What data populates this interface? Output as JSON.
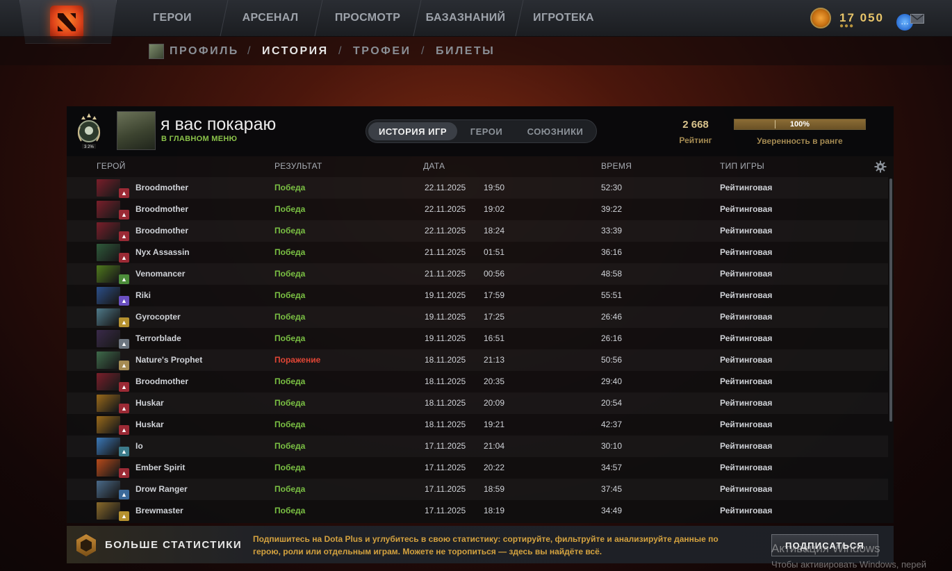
{
  "topnav": {
    "tabs": [
      "ГЕРОИ",
      "АРСЕНАЛ",
      "ПРОСМОТР",
      "БАЗАЗНАНИЙ",
      "ИГРОТЕКА"
    ],
    "currency": "17 050"
  },
  "subnav": {
    "items": [
      "ПРОФИЛЬ",
      "ИСТОРИЯ",
      "ТРОФЕИ",
      "БИЛЕТЫ"
    ],
    "active": "ИСТОРИЯ"
  },
  "player": {
    "name": "я вас покараю",
    "status": "В ГЛАВНОМ МЕНЮ",
    "rank_badge_text": "3 2%"
  },
  "segment_tabs": [
    "ИСТОРИЯ ИГР",
    "ГЕРОИ",
    "СОЮЗНИКИ"
  ],
  "rating": {
    "value": "2 668",
    "label": "Рейтинг",
    "confidence_text": "100%",
    "confidence_fraction": 1.0,
    "confidence_label": "Уверенность в ранге"
  },
  "columns": {
    "hero": "ГЕРОЙ",
    "result": "РЕЗУЛЬТАТ",
    "date": "ДАТА",
    "duration": "ВРЕМЯ",
    "mode": "ТИП ИГРЫ"
  },
  "matches": [
    {
      "hero": "Broodmother",
      "result": "Победа",
      "win": true,
      "date": "22.11.2025",
      "time": "19:50",
      "duration": "52:30",
      "mode": "Рейтинговая",
      "hero_color": "#7a1e2a",
      "role_color": "#9b2a35"
    },
    {
      "hero": "Broodmother",
      "result": "Победа",
      "win": true,
      "date": "22.11.2025",
      "time": "19:02",
      "duration": "39:22",
      "mode": "Рейтинговая",
      "hero_color": "#7a1e2a",
      "role_color": "#9b2a35"
    },
    {
      "hero": "Broodmother",
      "result": "Победа",
      "win": true,
      "date": "22.11.2025",
      "time": "18:24",
      "duration": "33:39",
      "mode": "Рейтинговая",
      "hero_color": "#7a1e2a",
      "role_color": "#9b2a35"
    },
    {
      "hero": "Nyx Assassin",
      "result": "Победа",
      "win": true,
      "date": "21.11.2025",
      "time": "01:51",
      "duration": "36:16",
      "mode": "Рейтинговая",
      "hero_color": "#2e5a3a",
      "role_color": "#9b2a35"
    },
    {
      "hero": "Venomancer",
      "result": "Победа",
      "win": true,
      "date": "21.11.2025",
      "time": "00:56",
      "duration": "48:58",
      "mode": "Рейтинговая",
      "hero_color": "#4f7a1c",
      "role_color": "#4c8c3a"
    },
    {
      "hero": "Riki",
      "result": "Победа",
      "win": true,
      "date": "19.11.2025",
      "time": "17:59",
      "duration": "55:51",
      "mode": "Рейтинговая",
      "hero_color": "#2b4f8a",
      "role_color": "#6a4fc0"
    },
    {
      "hero": "Gyrocopter",
      "result": "Победа",
      "win": true,
      "date": "19.11.2025",
      "time": "17:25",
      "duration": "26:46",
      "mode": "Рейтинговая",
      "hero_color": "#4f7a8a",
      "role_color": "#b5912f"
    },
    {
      "hero": "Terrorblade",
      "result": "Победа",
      "win": true,
      "date": "19.11.2025",
      "time": "16:51",
      "duration": "26:16",
      "mode": "Рейтинговая",
      "hero_color": "#3a2a4a",
      "role_color": "#6d7680"
    },
    {
      "hero": "Nature's Prophet",
      "result": "Поражение",
      "win": false,
      "date": "18.11.2025",
      "time": "21:13",
      "duration": "50:56",
      "mode": "Рейтинговая",
      "hero_color": "#3e6a4a",
      "role_color": "#a58b53"
    },
    {
      "hero": "Broodmother",
      "result": "Победа",
      "win": true,
      "date": "18.11.2025",
      "time": "20:35",
      "duration": "29:40",
      "mode": "Рейтинговая",
      "hero_color": "#7a1e2a",
      "role_color": "#9b2a35"
    },
    {
      "hero": "Huskar",
      "result": "Победа",
      "win": true,
      "date": "18.11.2025",
      "time": "20:09",
      "duration": "20:54",
      "mode": "Рейтинговая",
      "hero_color": "#9a6a1a",
      "role_color": "#9b2a35"
    },
    {
      "hero": "Huskar",
      "result": "Победа",
      "win": true,
      "date": "18.11.2025",
      "time": "19:21",
      "duration": "42:37",
      "mode": "Рейтинговая",
      "hero_color": "#9a6a1a",
      "role_color": "#9b2a35"
    },
    {
      "hero": "Io",
      "result": "Победа",
      "win": true,
      "date": "17.11.2025",
      "time": "21:04",
      "duration": "30:10",
      "mode": "Рейтинговая",
      "hero_color": "#3a78b8",
      "role_color": "#3c7b8a"
    },
    {
      "hero": "Ember Spirit",
      "result": "Победа",
      "win": true,
      "date": "17.11.2025",
      "time": "20:22",
      "duration": "34:57",
      "mode": "Рейтинговая",
      "hero_color": "#b84a1a",
      "role_color": "#9b2a35"
    },
    {
      "hero": "Drow Ranger",
      "result": "Победа",
      "win": true,
      "date": "17.11.2025",
      "time": "18:59",
      "duration": "37:45",
      "mode": "Рейтинговая",
      "hero_color": "#4a6a8a",
      "role_color": "#3c6a9a"
    },
    {
      "hero": "Brewmaster",
      "result": "Победа",
      "win": true,
      "date": "17.11.2025",
      "time": "18:19",
      "duration": "34:49",
      "mode": "Рейтинговая",
      "hero_color": "#8a6a2a",
      "role_color": "#b5912f"
    }
  ],
  "banner": {
    "title": "БОЛЬШЕ СТАТИСТИКИ",
    "text": "Подпишитесь на Dota Plus и углубитесь в свою статистику: сортируйте, фильтруйте и анализируйте данные по герою, роли или отдельным играм. Можете не торопиться — здесь вы найдёте всё.",
    "button": "ПОДПИСАТЬСЯ"
  },
  "watermark": {
    "line1": "Активация Windows",
    "line2": "Чтобы активировать Windows, перей"
  },
  "colors": {
    "win": "#7ac043",
    "loss": "#e04535",
    "gold": "#d4a23f"
  }
}
